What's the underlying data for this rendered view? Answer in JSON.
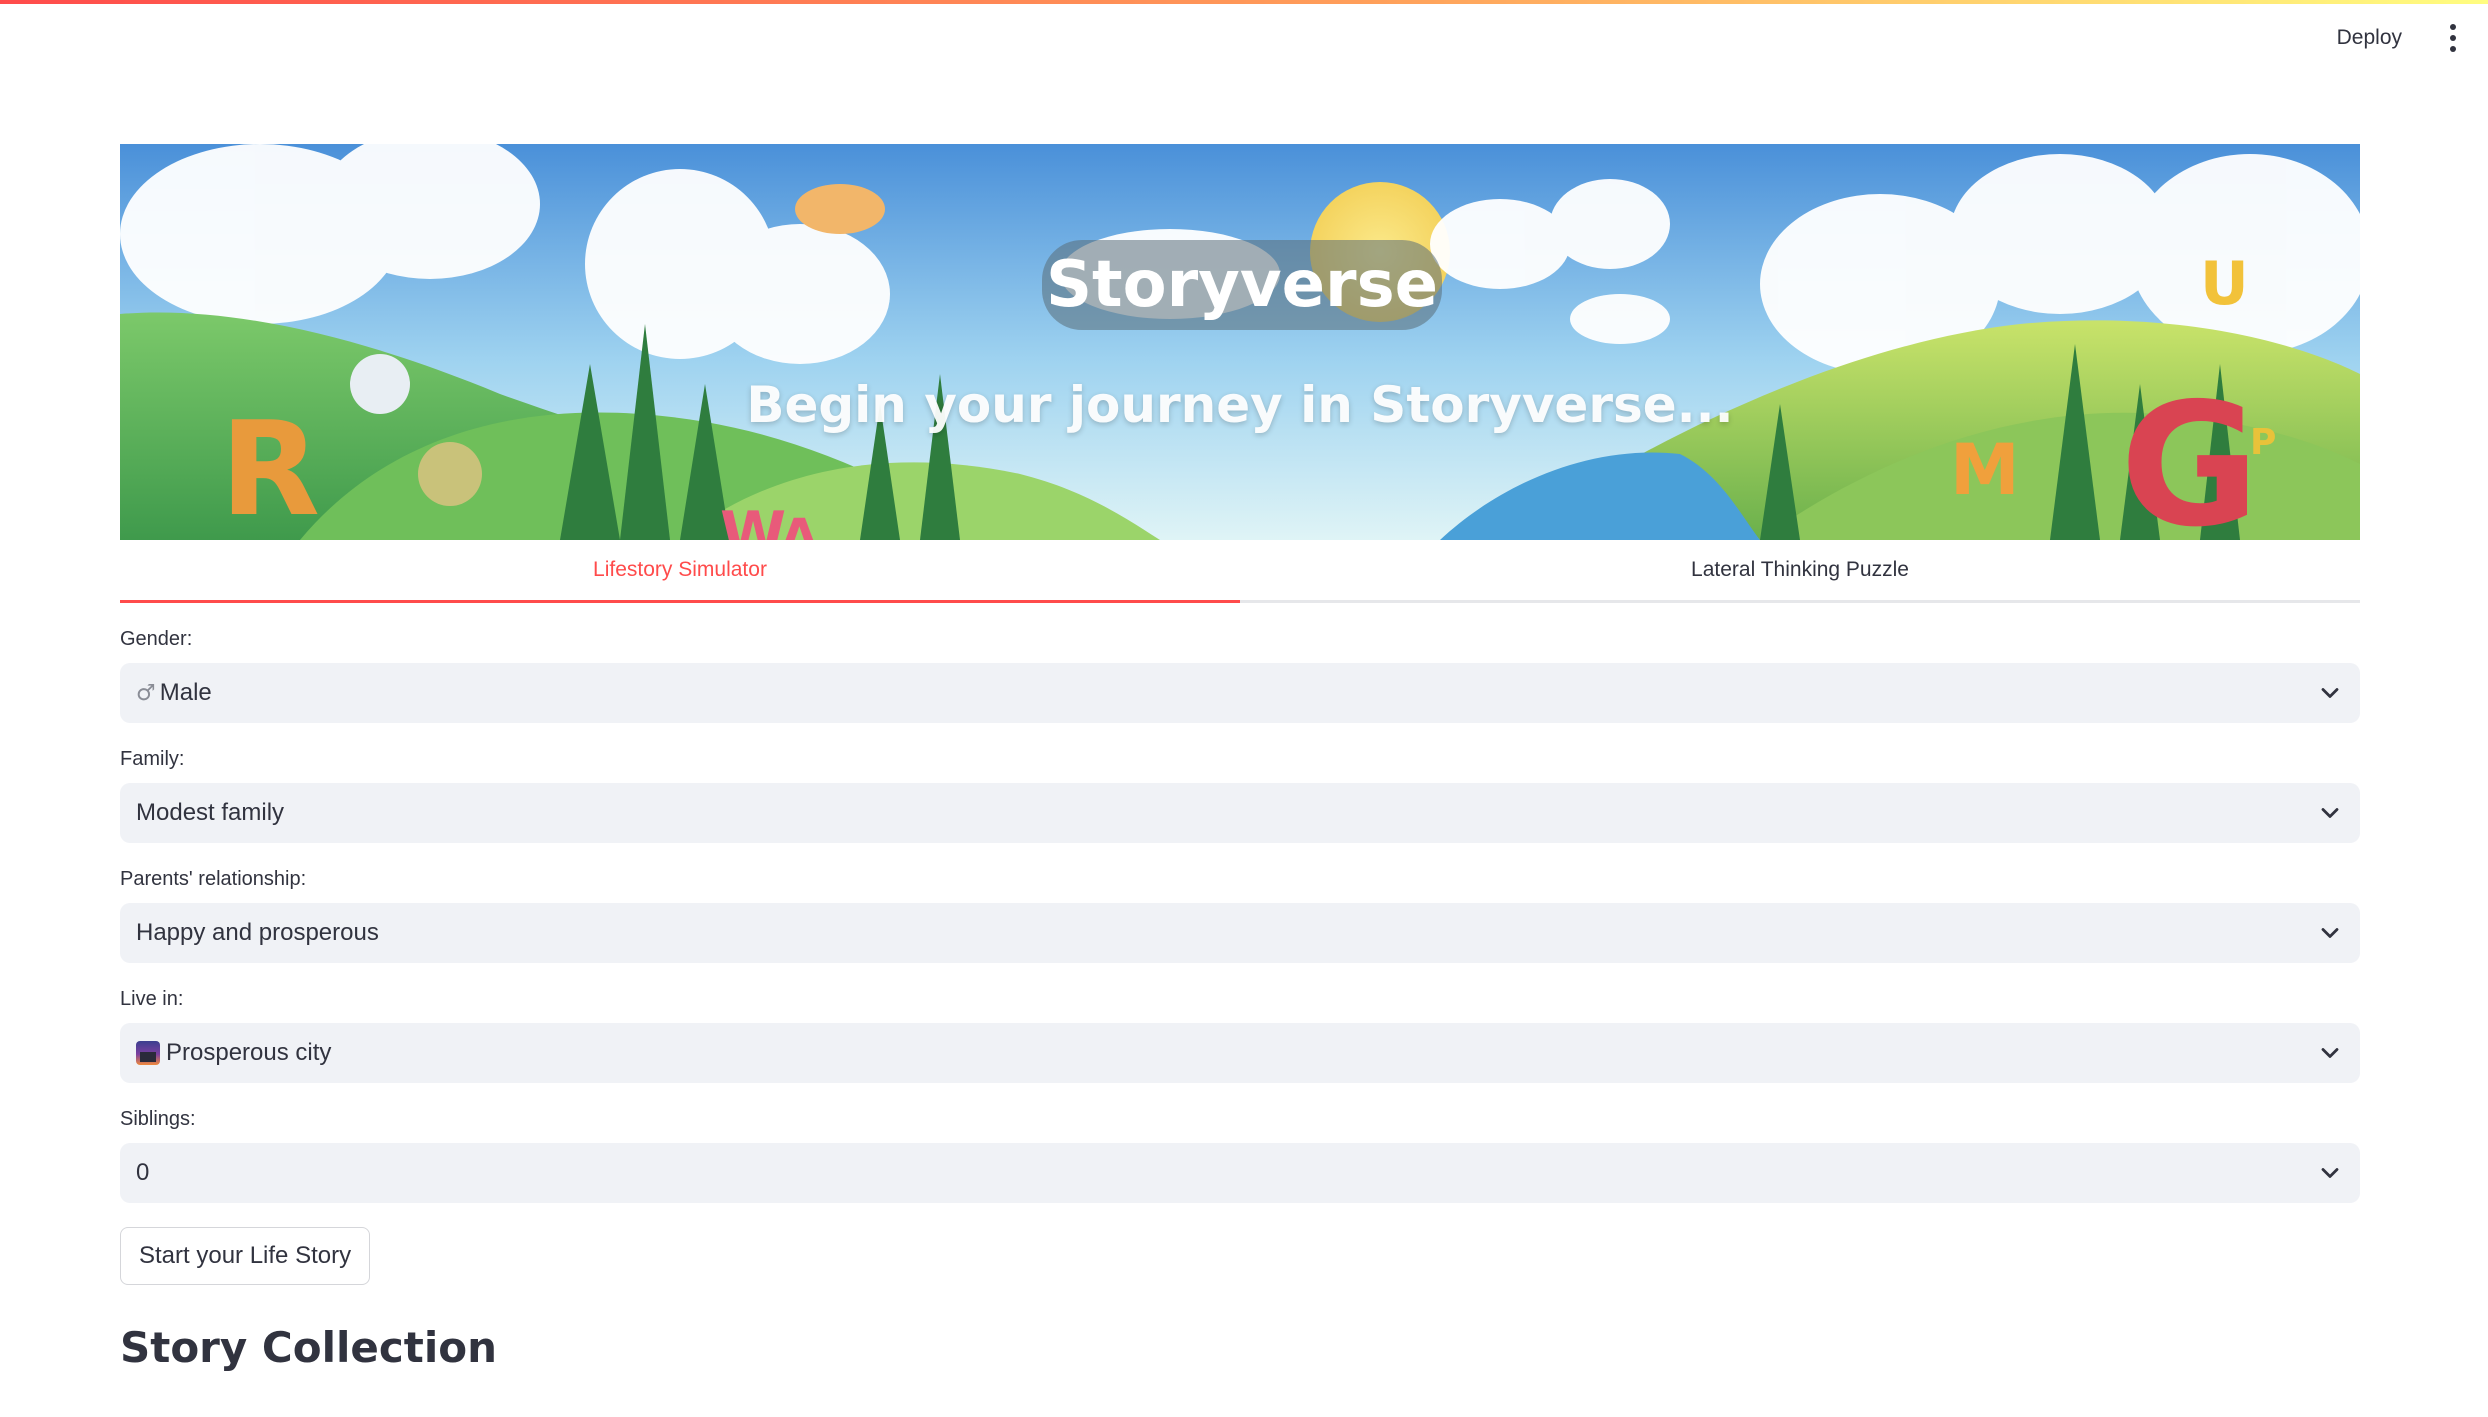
{
  "header": {
    "deploy_label": "Deploy",
    "menu_icon": "kebab-menu-icon"
  },
  "banner": {
    "title": "Storyverse",
    "subtitle": "Begin your journey in Storyverse..."
  },
  "tabs": [
    {
      "label": "Lifestory Simulator",
      "active": true
    },
    {
      "label": "Lateral Thinking Puzzle",
      "active": false
    }
  ],
  "form": {
    "gender": {
      "label": "Gender:",
      "value": "Male",
      "icon": "male-symbol-icon"
    },
    "family": {
      "label": "Family:",
      "value": "Modest family"
    },
    "parents": {
      "label": "Parents' relationship:",
      "value": "Happy and prosperous"
    },
    "live_in": {
      "label": "Live in:",
      "value": "Prosperous city",
      "icon": "city-sunset-icon"
    },
    "siblings": {
      "label": "Siblings:",
      "value": "0"
    }
  },
  "start_button": "Start your Life Story",
  "section_title": "Story Collection",
  "colors": {
    "accent": "#ff4b4b",
    "select_bg": "#f0f2f6",
    "text": "#31333f"
  }
}
